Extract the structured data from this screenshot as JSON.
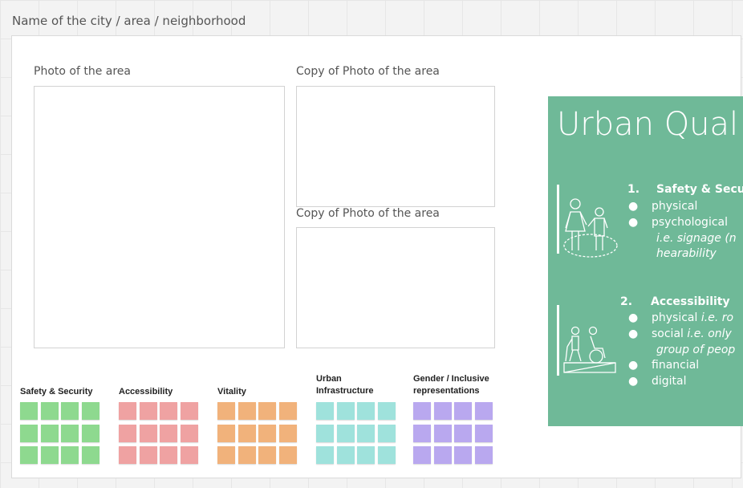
{
  "board": {
    "title": "Name of the city / area / neighborhood",
    "photos": [
      {
        "label": "Photo of the area"
      },
      {
        "label": "Copy of Photo of the area"
      },
      {
        "label": "Copy of Photo of the area"
      }
    ]
  },
  "categories": [
    {
      "label": "Safety & Security",
      "color": "#8ed98f"
    },
    {
      "label": "Accessibility",
      "color": "#efa2a2"
    },
    {
      "label": "Vitality",
      "color": "#f1b27b"
    },
    {
      "label": "Urban Infrastructure",
      "color": "#9fe2dc"
    },
    {
      "label": "Gender / Inclusive representations",
      "color": "#b9a8ef"
    }
  ],
  "card": {
    "title": "Urban Qual",
    "bg": "#6fb998",
    "item1": {
      "number": "1.",
      "title": "Safety & Secu",
      "b1": "physical",
      "b2": "psychological",
      "b2_cont1": "i.e. signage (n",
      "b2_cont2": "hearability"
    },
    "item2": {
      "number": "2.",
      "title": "Accessibility",
      "b1_text": "physical ",
      "b1_it": "i.e. ro",
      "b2_text": "social ",
      "b2_it": "i.e. only",
      "b2_cont": "group of peop",
      "b3": "financial",
      "b4": "digital"
    },
    "bullet": "●"
  }
}
